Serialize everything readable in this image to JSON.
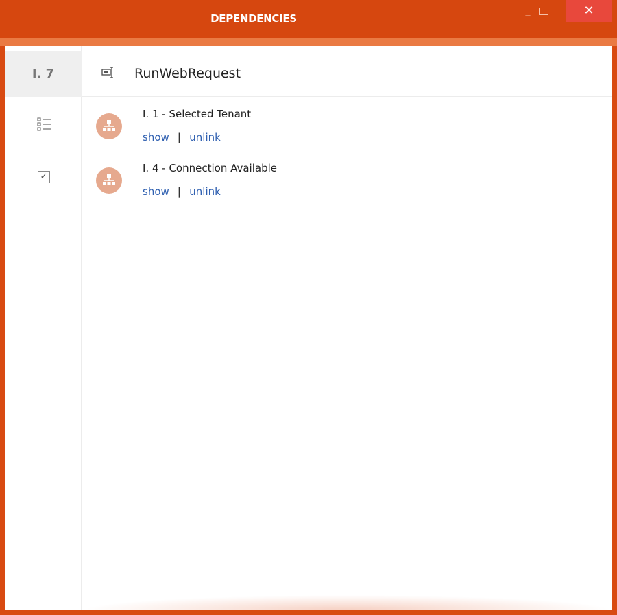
{
  "window": {
    "title": "DEPENDENCIES",
    "min_symbol": "_",
    "close_symbol": "✕"
  },
  "rail": {
    "id_label": "I. 7",
    "items": [
      {
        "icon": "list-icon"
      },
      {
        "icon": "checkbox-icon",
        "glyph": "✓"
      }
    ]
  },
  "header": {
    "icon": "web-request-icon",
    "title": "RunWebRequest"
  },
  "dependencies": [
    {
      "title": "I. 1 - Selected Tenant",
      "show": "show",
      "sep": "|",
      "unlink": "unlink",
      "icon": "hierarchy-icon"
    },
    {
      "title": "I. 4 - Connection Available",
      "show": "show",
      "sep": "|",
      "unlink": "unlink",
      "icon": "hierarchy-icon"
    }
  ],
  "colors": {
    "accent": "#d6470f",
    "accent_strip": "#ea7a43",
    "close_button": "#e8483c",
    "link": "#2e5fb0",
    "avatar": "#e6a98e"
  }
}
